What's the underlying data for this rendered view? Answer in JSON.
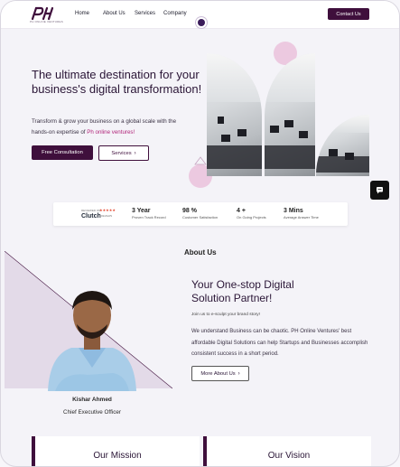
{
  "nav": {
    "links": [
      "Home",
      "About Us",
      "Services",
      "Company"
    ],
    "contact_label": "Contact Us",
    "logo_subtext": "PH ONLINE VENTURES"
  },
  "hero": {
    "title": "The ultimate destination for your business's digital transformation!",
    "subtitle_prefix": "Transform & grow your business on a global scale with the hands-on expertise of ",
    "subtitle_highlight": "Ph online ventures!",
    "primary_button": "Free Consultation",
    "secondary_button": "Services",
    "secondary_icon": "chevron-right-icon"
  },
  "stats": {
    "clutch_top": "REVIEWED ON",
    "clutch_stars": "★★★★★",
    "clutch_logo": "Clutch",
    "clutch_reviews": "4 REVIEWS",
    "items": [
      {
        "value": "3 Year",
        "label": "Proven Track Record"
      },
      {
        "value": "98 %",
        "label": "Customer Satisfaction"
      },
      {
        "value": "4 +",
        "label": "On Going Projects"
      },
      {
        "value": "3 Mins",
        "label": "Average Answer Time"
      }
    ]
  },
  "about": {
    "heading": "About Us",
    "title": "Your One-stop Digital Solution Partner!",
    "tagline": "Join us to e-sculpt your brand story!",
    "body": "We understand Business can be chaotic. PH Online Ventures' best affordable Digital Solutions can help Startups and Businesses accomplish consistent success in a short period.",
    "button": "More About Us",
    "button_icon": "chevron-right-icon",
    "ceo_name": "Kishar Ahmed",
    "ceo_role": "Chief Executive Officer"
  },
  "cards": {
    "mission": "Our Mission",
    "vision": "Our Vision"
  },
  "colors": {
    "brand": "#3f0f3c",
    "accent_pink": "#b1257a",
    "circle_pink": "#ecc9e0",
    "triangle": "#ddd3e3"
  },
  "icons": {
    "chat": "chat-icon",
    "logo": "brand-logo"
  }
}
